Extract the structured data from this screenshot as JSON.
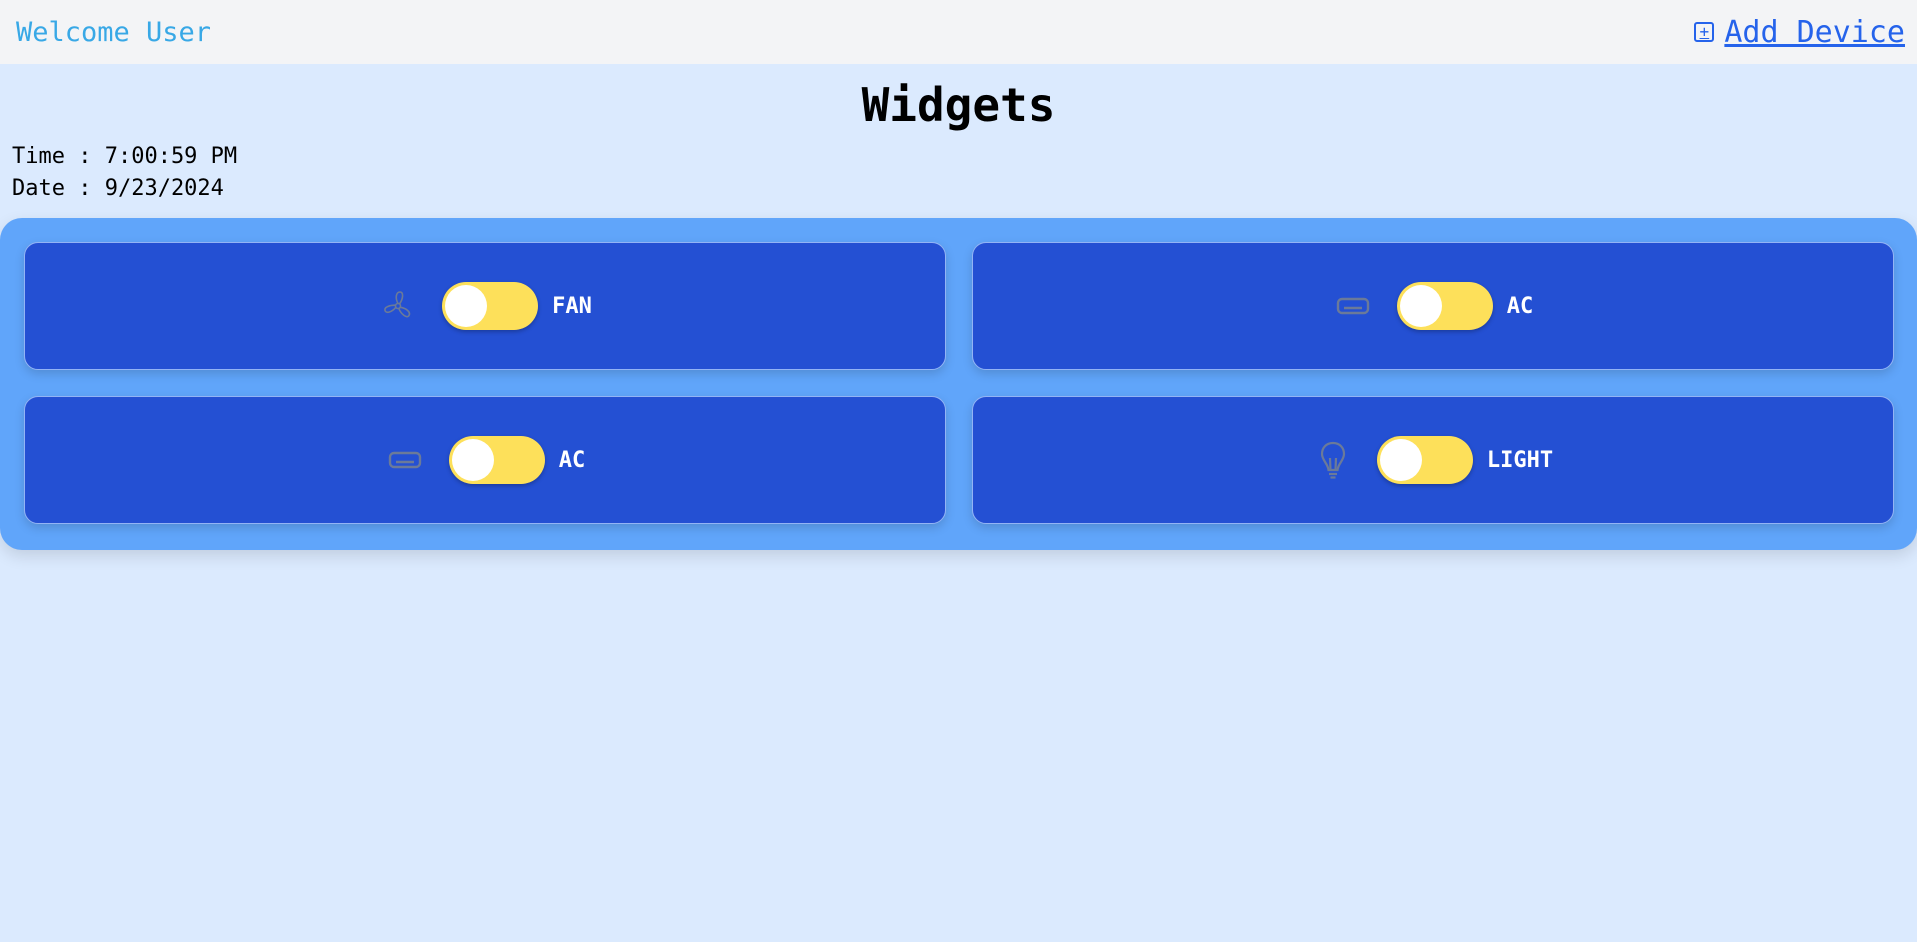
{
  "header": {
    "welcome": "Welcome User",
    "add_device_label": "Add Device",
    "add_device_icon": "plus-square-icon"
  },
  "main": {
    "title": "Widgets",
    "time_text": "Time : 7:00:59 PM",
    "date_text": "Date : 9/23/2024"
  },
  "devices": [
    {
      "label": "FAN",
      "icon": "fan-icon",
      "on": false
    },
    {
      "label": "AC",
      "icon": "air-conditioner-icon",
      "on": false
    },
    {
      "label": "AC",
      "icon": "air-conditioner-icon",
      "on": false
    },
    {
      "label": "LIGHT",
      "icon": "lightbulb-icon",
      "on": false
    }
  ],
  "colors": {
    "background": "#dbeafe",
    "panel": "#60a5fa",
    "card": "#2450d3",
    "toggle": "#fde05a",
    "welcome_text": "#38a8e6",
    "link": "#2563eb"
  }
}
